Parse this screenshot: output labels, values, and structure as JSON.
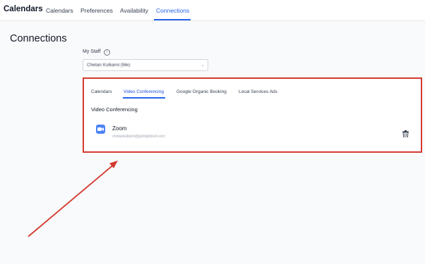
{
  "header": {
    "app_title": "Calendars",
    "tabs": [
      {
        "label": "Calendars"
      },
      {
        "label": "Preferences"
      },
      {
        "label": "Availability"
      },
      {
        "label": "Connections"
      }
    ]
  },
  "page": {
    "title": "Connections",
    "staff_label": "My Staff",
    "info_glyph": "i",
    "staff_value": "Chetan Kulkarni (Me)"
  },
  "panel": {
    "tabs": [
      {
        "label": "Calendars"
      },
      {
        "label": "Video Conferencing"
      },
      {
        "label": "Google Organic Booking"
      },
      {
        "label": "Local Services Ads"
      }
    ],
    "section_title": "Video Conferencing",
    "connection": {
      "name": "Zoom",
      "account": "chetankulkarni@gohighlevel.com"
    }
  },
  "colors": {
    "accent": "#2563eb",
    "annotation": "#d43a2f",
    "zoom": "#4b83f5"
  },
  "icons": [
    "info-icon",
    "chevron-down-icon",
    "zoom-icon",
    "trash-icon",
    "annotation-arrow"
  ]
}
